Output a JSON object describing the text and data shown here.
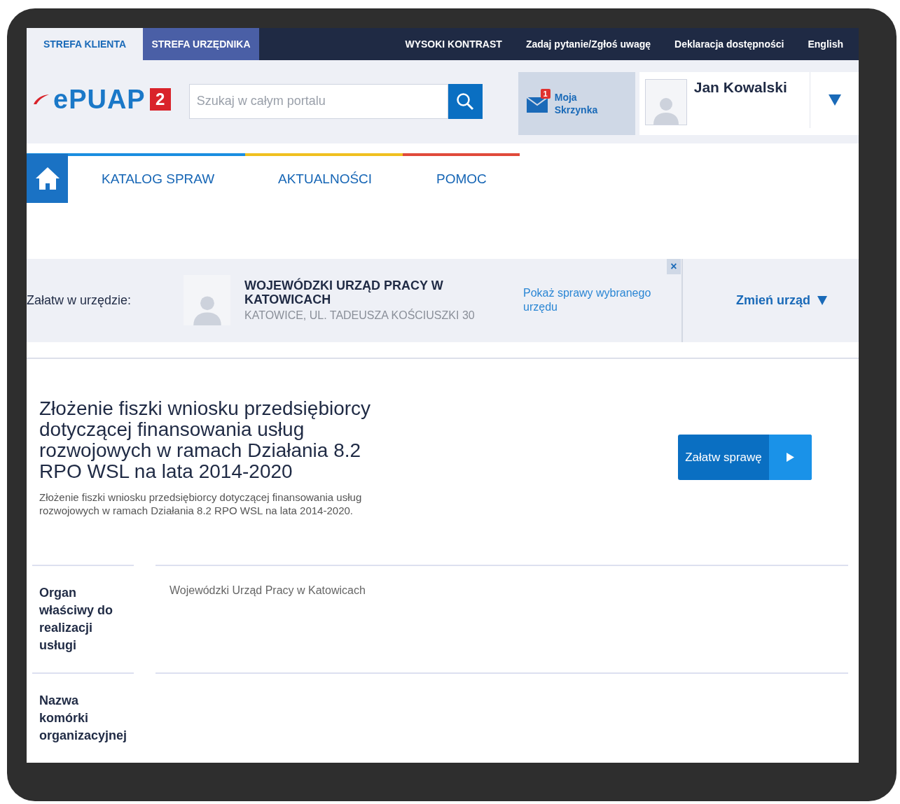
{
  "top_bar": {
    "zones": [
      {
        "label": "STREFA KLIENTA",
        "selected": true
      },
      {
        "label": "STREFA URZĘDNIKA",
        "selected": false
      }
    ],
    "links": [
      "WYSOKI KONTRAST",
      "Zadaj pytanie/Zgłoś uwagę",
      "Deklaracja dostępności",
      "English"
    ]
  },
  "header": {
    "logo": {
      "text": "ePUAP",
      "badge": "2"
    },
    "search": {
      "placeholder": "Szukaj w całym portalu"
    },
    "mailbox": {
      "label": "Moja Skrzynka",
      "count": "1"
    },
    "user": {
      "name": "Jan Kowalski"
    }
  },
  "nav": {
    "items": [
      "KATALOG SPRAW",
      "AKTUALNOŚCI",
      "POMOC"
    ]
  },
  "office_bar": {
    "label": "Załatw w urzędzie:",
    "name": "WOJEWÓDZKI URZĄD PRACY W KATOWICACH",
    "address": "KATOWICE, UL. TADEUSZA KOŚCIUSZKI 30",
    "link": "Pokaż sprawy wybranego urzędu",
    "close": "×",
    "change": "Zmień urząd"
  },
  "service": {
    "title": "Złożenie fiszki wniosku przedsiębiorcy dotyczącej finansowania usług rozwojowych w ramach Działania 8.2 RPO WSL na lata 2014-2020",
    "description": "Złożenie fiszki wniosku przedsiębiorcy dotyczącej finansowania usług rozwojowych w ramach Działania 8.2 RPO WSL na lata 2014-2020.",
    "action": "Załatw sprawę"
  },
  "details": [
    {
      "label": "Organ właściwy do realizacji usługi",
      "value": "Wojewódzki Urząd Pracy w Katowicach"
    },
    {
      "label": "Nazwa komórki organizacyjnej"
    }
  ]
}
